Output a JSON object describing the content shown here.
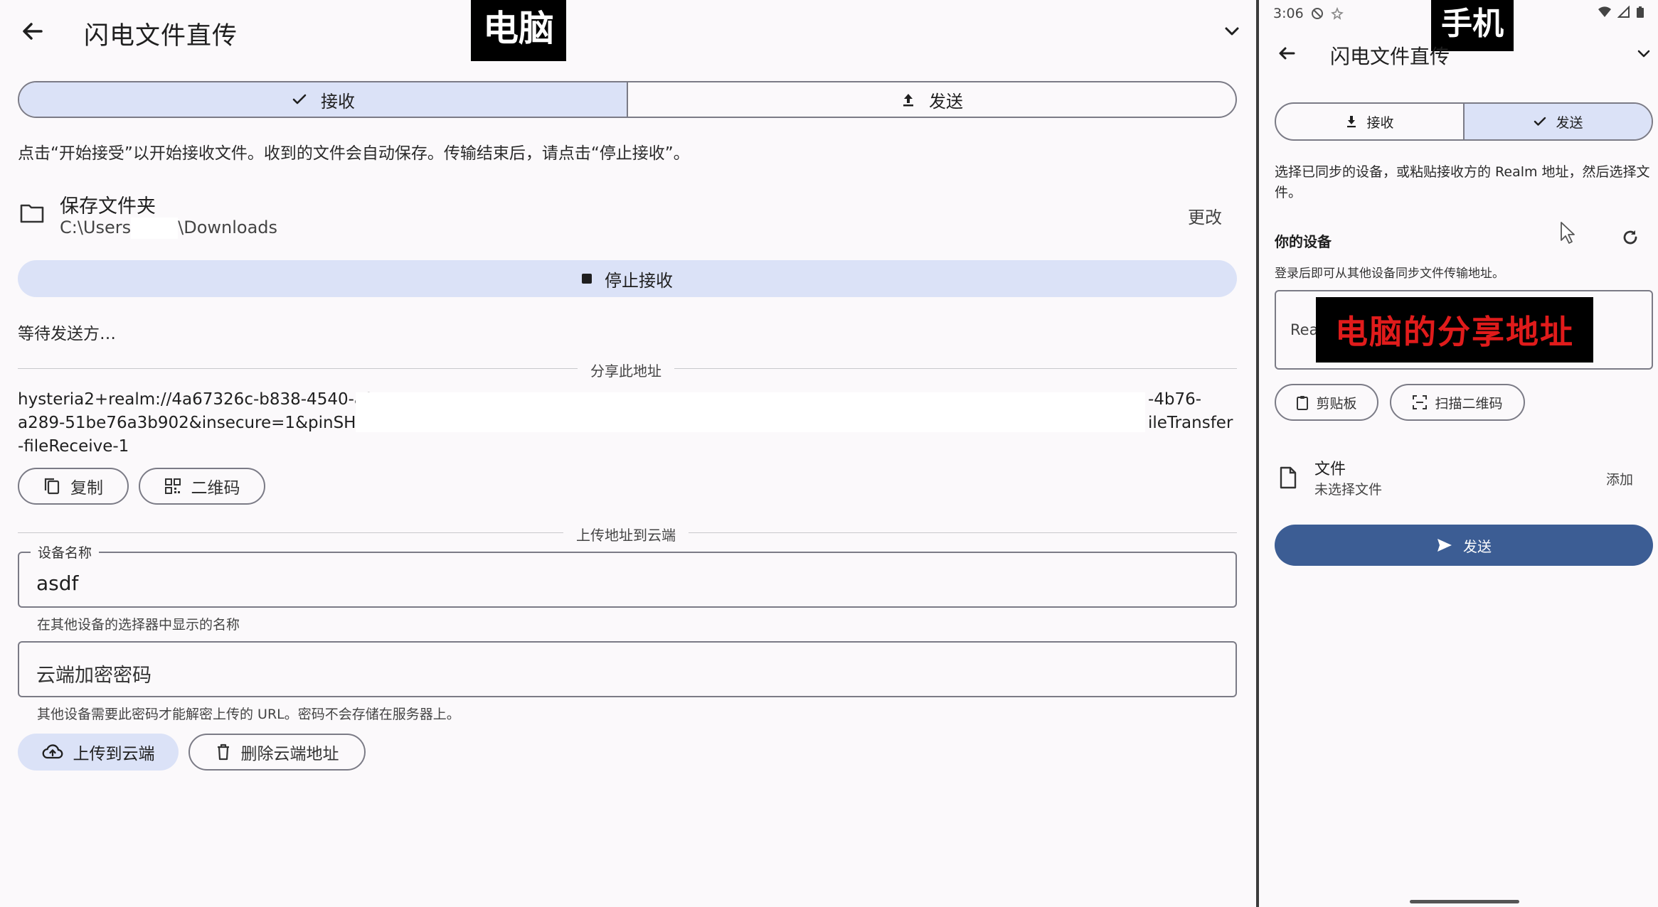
{
  "desktop": {
    "label": "电脑",
    "title": "闪电文件直传",
    "tabs": [
      {
        "label": "接收",
        "active": true
      },
      {
        "label": "发送",
        "active": false
      }
    ],
    "instruction": "点击“开始接受”以开始接收文件。收到的文件会自动保存。传输结束后，请点击“停止接收”。",
    "folder": {
      "title": "保存文件夹",
      "path_start": "C:\\Users",
      "path_end": "\\Downloads",
      "change_label": "更改"
    },
    "stop_label": "停止接收",
    "waiting_text": "等待发送方…",
    "share_section_label": "分享此地址",
    "share_url": {
      "line1_start": "hysteria2+realm://4a67326c-b838-4540-a2",
      "line1_end": "-4b76-",
      "line2_start": "a289-51be76a3b902&insecure=1&pinSHA2",
      "line2_end": "ileTransfer",
      "line3": "-fileReceive-1"
    },
    "copy_label": "复制",
    "qr_label": "二维码",
    "upload_section_label": "上传地址到云端",
    "device_name": {
      "label": "设备名称",
      "value": "asdf",
      "helper": "在其他设备的选择器中显示的名称"
    },
    "cloud_password": {
      "placeholder": "云端加密密码",
      "helper": "其他设备需要此密码才能解密上传的 URL。密码不会存储在服务器上。"
    },
    "upload_label": "上传到云端",
    "delete_label": "删除云端地址"
  },
  "phone": {
    "label": "手机",
    "status_time": "3:06",
    "title": "闪电文件直传",
    "tabs": [
      {
        "label": "接收",
        "active": false
      },
      {
        "label": "发送",
        "active": true
      }
    ],
    "instruction": "选择已同步的设备，或粘贴接收方的 Realm 地址，然后选择文件。",
    "devices_title": "你的设备",
    "login_hint": "登录后即可从其他设备同步文件传输地址。",
    "realm_field_placeholder": "Rea",
    "overlay_text": "电脑的分享地址",
    "clipboard_label": "剪贴板",
    "scan_label": "扫描二维码",
    "file": {
      "title": "文件",
      "subtitle": "未选择文件",
      "add_label": "添加"
    },
    "send_label": "发送"
  },
  "colors": {
    "active_tab": "#dbe2f7",
    "primary": "#3c5d94",
    "overlay_red": "#e01b1b"
  }
}
